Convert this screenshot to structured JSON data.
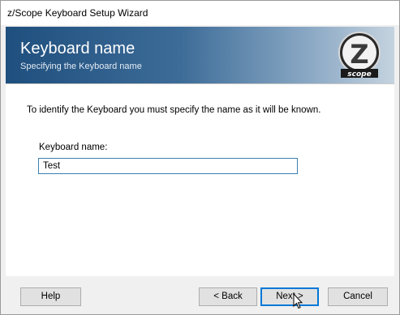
{
  "window": {
    "title": "z/Scope Keyboard Setup Wizard"
  },
  "banner": {
    "title": "Keyboard name",
    "subtitle": "Specifying the Keyboard name",
    "logo": {
      "letter": "Z",
      "text": "scope"
    }
  },
  "content": {
    "instruction": "To identify the Keyboard you must specify the name as it will be known.",
    "keyboard_name_label": "Keyboard name:",
    "keyboard_name_value": "Test"
  },
  "buttons": {
    "help": "Help",
    "back": "< Back",
    "next": "Next >",
    "cancel": "Cancel"
  },
  "colors": {
    "banner_dark": "#1f4f7e",
    "banner_light": "#c5d3df",
    "focus_blue": "#0078d7"
  },
  "icons": [
    "zscope-logo-icon",
    "mouse-cursor-icon"
  ]
}
